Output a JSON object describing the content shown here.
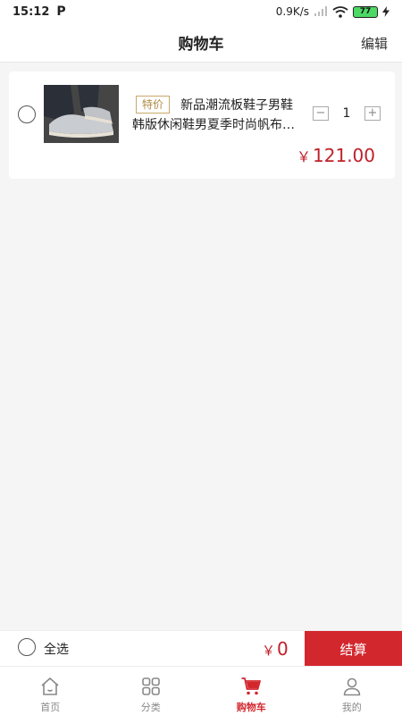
{
  "status_bar": {
    "time": "15:12",
    "p_badge": "P",
    "speed": "0.9K/s",
    "battery": "77"
  },
  "header": {
    "title": "购物车",
    "edit": "编辑"
  },
  "cart": {
    "items": [
      {
        "tag": "特价",
        "title_line1": "新品潮流板鞋子男鞋",
        "title_line2": "韩版休闲鞋男夏季时尚帆布…",
        "quantity": "1",
        "currency": "￥",
        "price": "121.00"
      }
    ]
  },
  "checkout": {
    "select_all": "全选",
    "currency": "￥",
    "total": "0",
    "button": "结算"
  },
  "tabbar": {
    "active_color": "#d3272e",
    "items": [
      {
        "label": "首页",
        "icon": "home-icon"
      },
      {
        "label": "分类",
        "icon": "grid-icon"
      },
      {
        "label": "购物车",
        "icon": "cart-icon"
      },
      {
        "label": "我的",
        "icon": "user-icon"
      }
    ]
  }
}
